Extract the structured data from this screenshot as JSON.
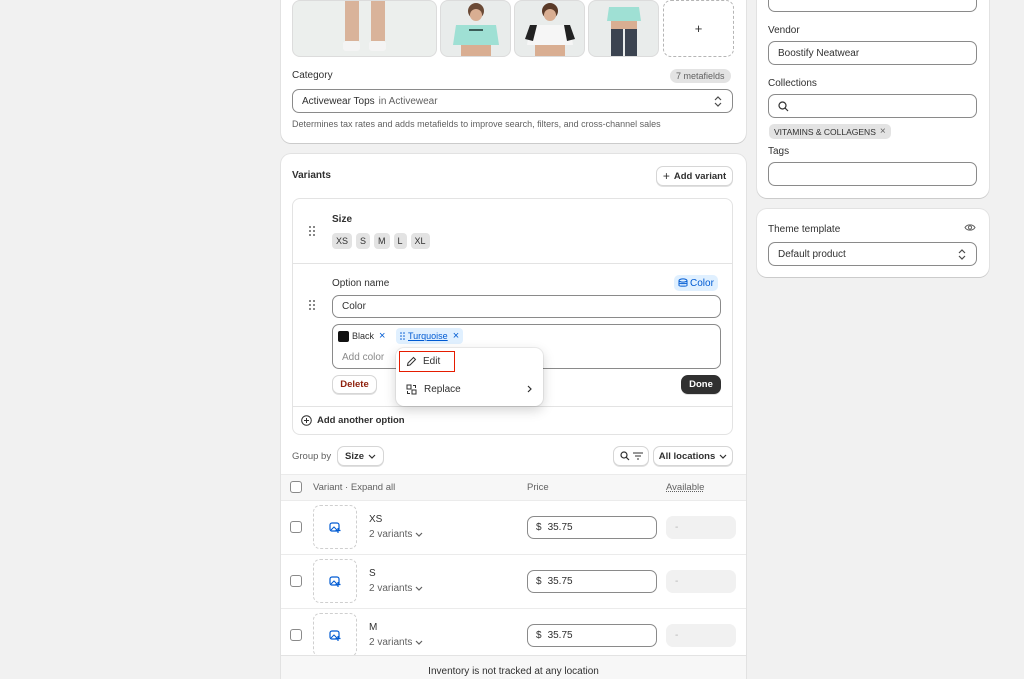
{
  "media": {
    "add_label": "+"
  },
  "category": {
    "label": "Category",
    "metafields_badge": "7 metafields",
    "value_main": "Activewear Tops",
    "value_in": "in Activewear",
    "help": "Determines tax rates and adds metafields to improve search, filters, and cross-channel sales"
  },
  "variants": {
    "title": "Variants",
    "add_variant": "Add variant",
    "size_option": {
      "name": "Size",
      "values": [
        "XS",
        "S",
        "M",
        "L",
        "XL"
      ]
    },
    "color_option": {
      "option_name_label": "Option name",
      "color_badge": "Color",
      "option_name_value": "Color",
      "values": [
        {
          "name": "Black",
          "swatch": "#111111"
        },
        {
          "name": "Turquoise",
          "swatch": ""
        }
      ],
      "add_placeholder": "Add color",
      "delete_label": "Delete",
      "done_label": "Done"
    },
    "context_menu": {
      "edit": "Edit",
      "replace": "Replace"
    },
    "add_another_option": "Add another option",
    "group_by_label": "Group by",
    "group_by_value": "Size",
    "all_locations": "All locations",
    "table": {
      "col_variant": "Variant",
      "expand_all": "Expand all",
      "col_price": "Price",
      "col_available": "Available",
      "rows": [
        {
          "name": "XS",
          "sub": "2 variants",
          "currency": "$",
          "price": "35.75",
          "available": "-"
        },
        {
          "name": "S",
          "sub": "2 variants",
          "currency": "$",
          "price": "35.75",
          "available": "-"
        },
        {
          "name": "M",
          "sub": "2 variants",
          "currency": "$",
          "price": "35.75",
          "available": "-"
        }
      ],
      "footer": "Inventory is not tracked at any location"
    }
  },
  "organization": {
    "vendor_label": "Vendor",
    "vendor_value": "Boostify Neatwear",
    "collections_label": "Collections",
    "collection_tag": "VITAMINS & COLLAGENS",
    "tags_label": "Tags"
  },
  "theme": {
    "label": "Theme template",
    "value": "Default product"
  },
  "colors": {
    "accent": "#005bd3",
    "critical": "#8e1f0b",
    "highlight": "#e51c00",
    "dark_button": "#303030"
  }
}
